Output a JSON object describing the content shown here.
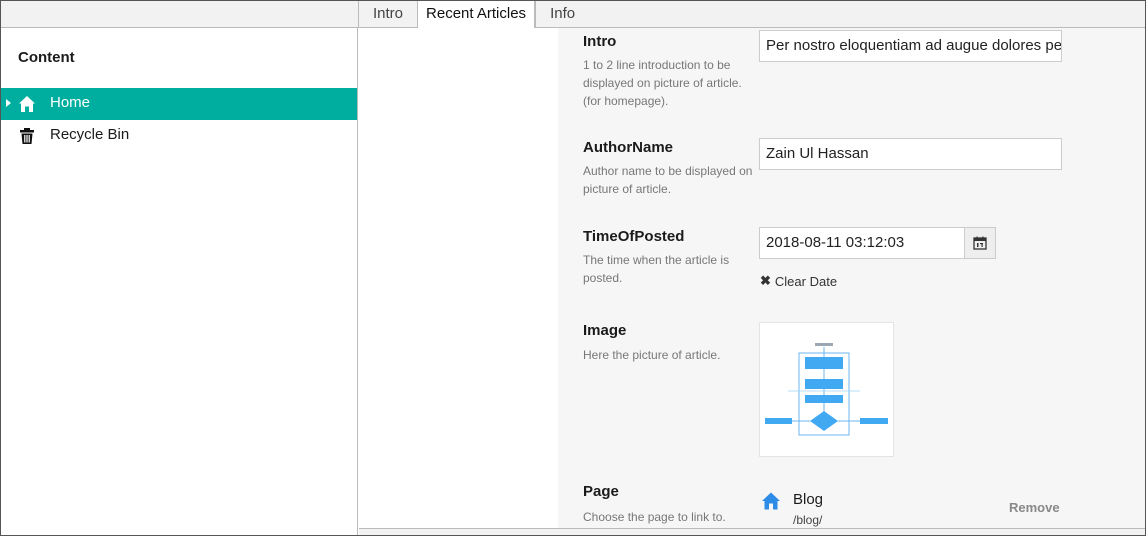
{
  "tabs": [
    {
      "label": "Intro"
    },
    {
      "label": "Recent Articles"
    },
    {
      "label": "Info"
    }
  ],
  "sidebar": {
    "title": "Content",
    "items": [
      {
        "label": "Home",
        "icon": "home-icon",
        "active": true
      },
      {
        "label": "Recycle Bin",
        "icon": "trash-icon",
        "active": false
      }
    ]
  },
  "properties": {
    "intro": {
      "label": "Intro",
      "description": "1 to 2 line introduction to be displayed on picture of article. (for homepage).",
      "value": "Per nostro eloquentiam ad augue dolores pe"
    },
    "author": {
      "label": "AuthorName",
      "description": "Author name to be displayed on picture of article.",
      "value": "Zain Ul Hassan"
    },
    "time": {
      "label": "TimeOfPosted",
      "description": "The time when the article is posted.",
      "value": "2018-08-11 03:12:03",
      "clear_label": "Clear Date"
    },
    "image": {
      "label": "Image",
      "description": "Here the picture of article."
    },
    "page": {
      "label": "Page",
      "description": "Choose the page to link to.",
      "link_name": "Blog",
      "link_url": "/blog/",
      "remove_label": "Remove"
    }
  },
  "colors": {
    "accent": "#00aea0",
    "link_icon": "#2d8ce6"
  }
}
